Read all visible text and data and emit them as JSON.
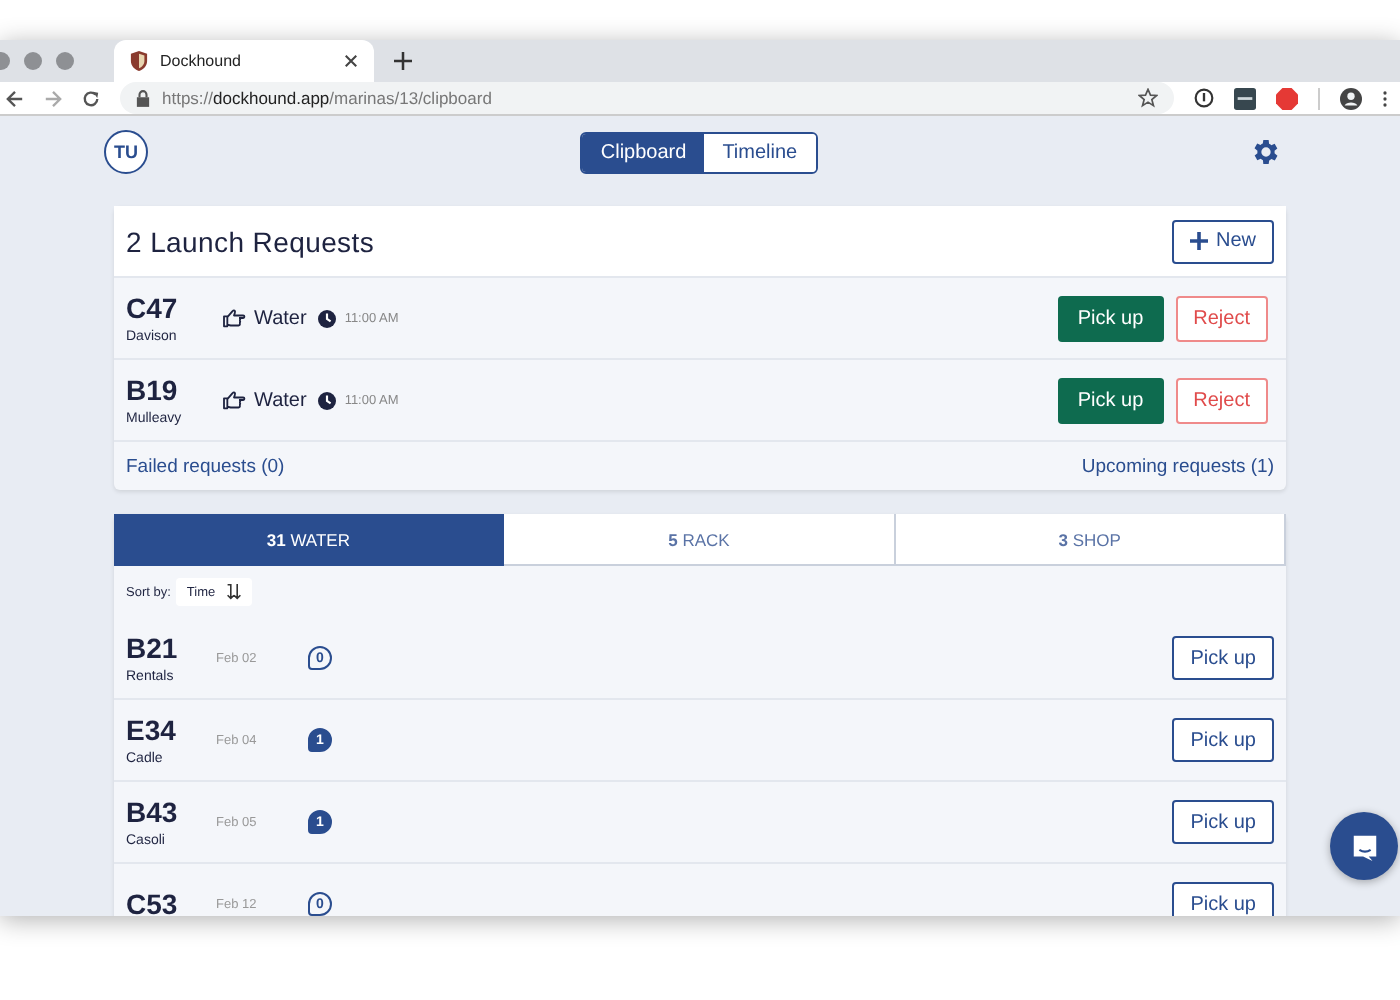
{
  "browser": {
    "tab_title": "Dockhound",
    "url": "https://**dockhound.app**/marinas/13/clipboard"
  },
  "header": {
    "avatar": "TU",
    "views": [
      {
        "label": "Clipboard",
        "selected": true
      },
      {
        "label": "Timeline",
        "selected": false
      }
    ]
  },
  "launch_requests": {
    "title": "2 Launch Requests",
    "new_button": "New",
    "rows": [
      {
        "berth": "C47",
        "owner": "Davison",
        "location": "Water",
        "time": "11:00 AM",
        "pickup_button": "Pick up",
        "reject_button": "Reject"
      },
      {
        "berth": "B19",
        "owner": "Mulleavy",
        "location": "Water",
        "time": "11:00 AM",
        "pickup_button": "Pick up",
        "reject_button": "Reject"
      }
    ],
    "failed_link": "Failed requests (0)",
    "upcoming_link": "Upcoming requests (1)"
  },
  "queue": {
    "tabs": [
      {
        "label": "**31** WATER",
        "selected": true
      },
      {
        "label": "**5** RACK",
        "selected": false
      },
      {
        "label": "**3** SHOP",
        "selected": false
      }
    ],
    "sort_label": "Sort by:",
    "sort_value": "Time",
    "rows": [
      {
        "berth": "B21",
        "owner": "Rentals",
        "date": "Feb 02",
        "comments": "0",
        "unread": false,
        "button": "Pick up"
      },
      {
        "berth": "E34",
        "owner": "Cadle",
        "date": "Feb 04",
        "comments": "1",
        "unread": true,
        "button": "Pick up"
      },
      {
        "berth": "B43",
        "owner": "Casoli",
        "date": "Feb 05",
        "comments": "1",
        "unread": true,
        "button": "Pick up"
      },
      {
        "berth": "C53",
        "date": "Feb 12",
        "comments": "0",
        "unread": false,
        "button": "Pick up"
      }
    ]
  }
}
